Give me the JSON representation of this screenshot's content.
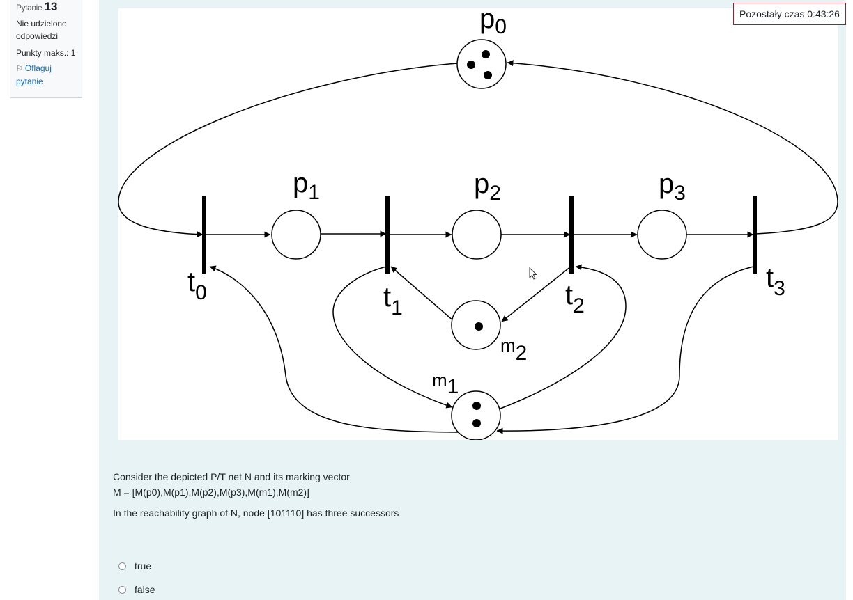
{
  "question_info": {
    "label": "Pytanie",
    "number": "13",
    "state": "Nie udzielono odpowiedzi",
    "grade": "Punkty maks.: 1",
    "flag_label": "Oflaguj pytanie"
  },
  "timer": {
    "text": "Pozostały czas 0:43:26"
  },
  "petri_net": {
    "places": [
      {
        "name": "p",
        "sub": "0",
        "tokens": 3
      },
      {
        "name": "p",
        "sub": "1",
        "tokens": 0
      },
      {
        "name": "p",
        "sub": "2",
        "tokens": 0
      },
      {
        "name": "p",
        "sub": "3",
        "tokens": 0
      },
      {
        "name": "m",
        "sub": "1",
        "tokens": 2
      },
      {
        "name": "m",
        "sub": "2",
        "tokens": 1
      }
    ],
    "transitions": [
      {
        "name": "t",
        "sub": "0"
      },
      {
        "name": "t",
        "sub": "1"
      },
      {
        "name": "t",
        "sub": "2"
      },
      {
        "name": "t",
        "sub": "3"
      }
    ]
  },
  "question": {
    "line1": "Consider the depicted P/T net N and its marking vector",
    "line2": "M = [M(p0),M(p1),M(p2),M(p3),M(m1),M(m2)]",
    "claim": "In the reachability graph of N, node [101110] has three successors"
  },
  "answers": [
    {
      "label": "true"
    },
    {
      "label": "false"
    }
  ]
}
